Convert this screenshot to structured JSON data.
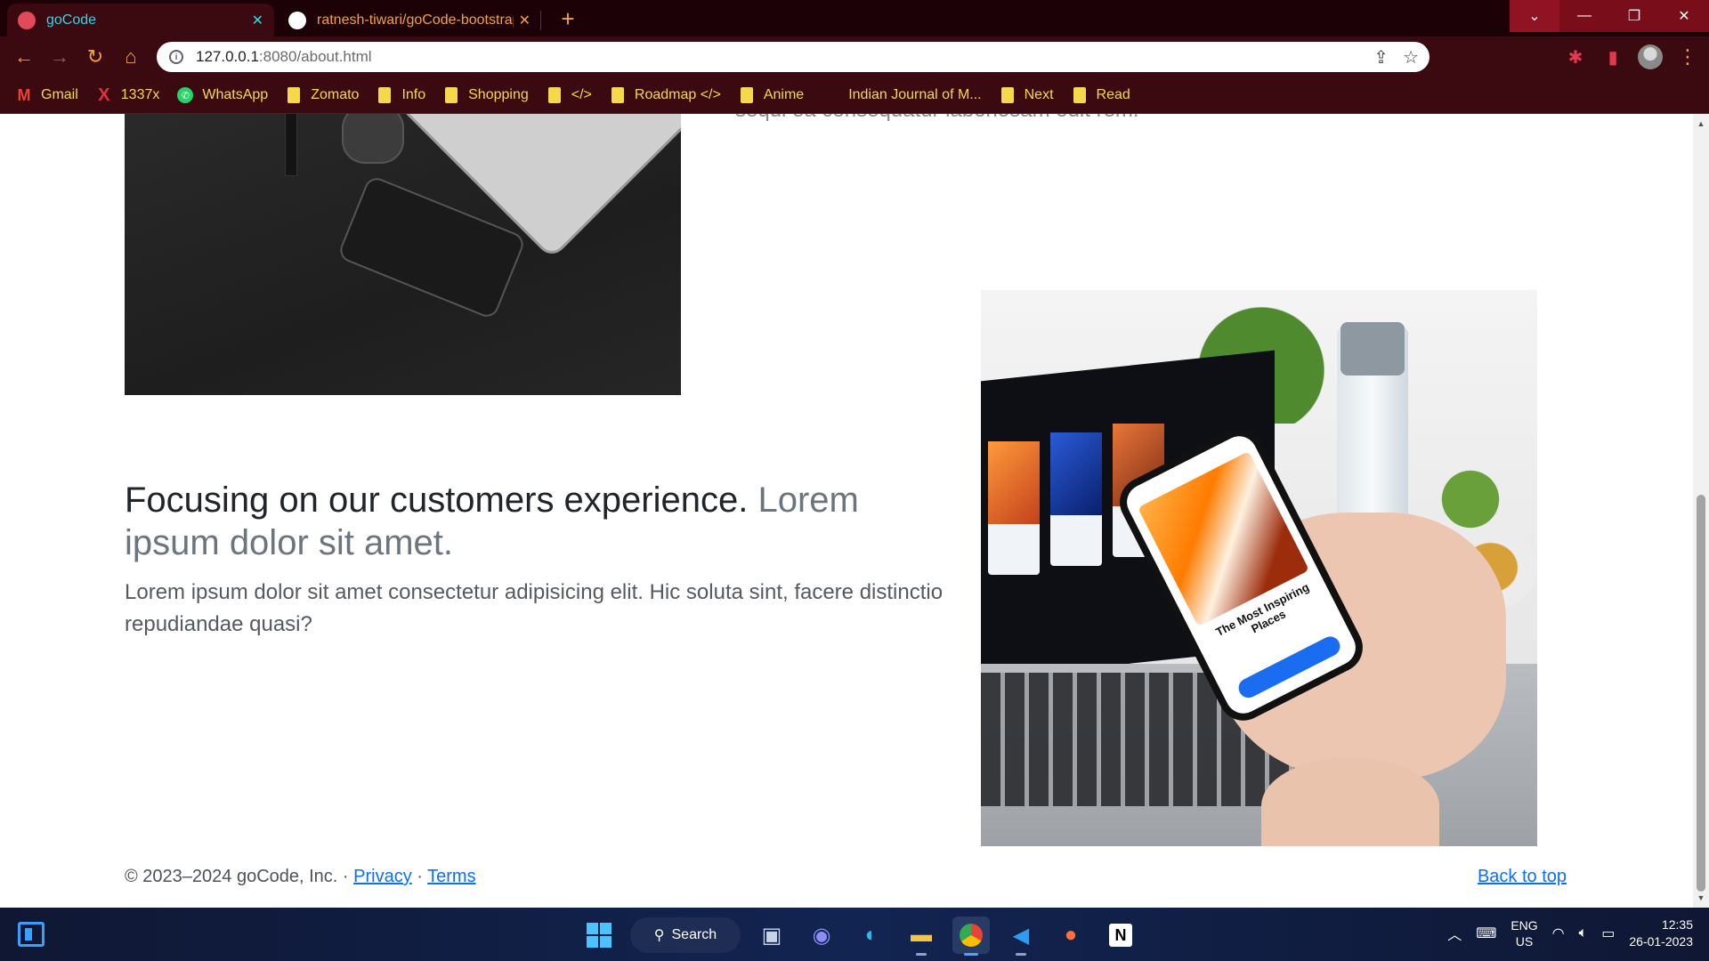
{
  "browser": {
    "tabs": [
      {
        "title": "goCode",
        "active": true
      },
      {
        "title": "ratnesh-tiwari/goCode-bootstrap",
        "active": false
      }
    ],
    "new_tab_label": "+",
    "url_host": "127.0.0.1",
    "url_rest": ":8080/about.html",
    "bookmarks": [
      {
        "label": "Gmail",
        "icon": "gmail-icon"
      },
      {
        "label": "1337x",
        "icon": "x-icon"
      },
      {
        "label": "WhatsApp",
        "icon": "whatsapp-icon"
      },
      {
        "label": "Zomato",
        "icon": "folder-icon"
      },
      {
        "label": "Info",
        "icon": "folder-icon"
      },
      {
        "label": "Shopping",
        "icon": "folder-icon"
      },
      {
        "label": "</>",
        "icon": "folder-icon"
      },
      {
        "label": "Roadmap </>",
        "icon": "folder-icon"
      },
      {
        "label": "Anime",
        "icon": "folder-icon"
      },
      {
        "label": "Indian Journal of M...",
        "icon": "none"
      },
      {
        "label": "Next",
        "icon": "folder-icon"
      },
      {
        "label": "Read",
        "icon": "folder-icon"
      }
    ],
    "colors": {
      "frame": "#1c0206",
      "toolbar": "#3a0a10",
      "accent_orange": "#f2a23c",
      "active_tab_text": "#34d5e6",
      "bookmark_text": "#f7d84a"
    }
  },
  "page": {
    "top_text_fragment": "sequi ea consequatur laboriosam odit rem.",
    "feature": {
      "heading_main": "Focusing on our customers experience.",
      "heading_muted": " Lorem ipsum dolor sit amet.",
      "lead": "Lorem ipsum dolor sit amet consectetur adipisicing elit. Hic soluta sint, facere distinctio repudiandae quasi?"
    },
    "phone_screen_title": "The Most Inspiring Places",
    "footer": {
      "copyright": "© 2023–2024 goCode, Inc. · ",
      "privacy": "Privacy",
      "separator": " · ",
      "terms": "Terms",
      "back_to_top": "Back to top"
    }
  },
  "taskbar": {
    "search_label": "Search",
    "lang_line1": "ENG",
    "lang_line2": "US",
    "time": "12:35",
    "date": "26-01-2023"
  }
}
